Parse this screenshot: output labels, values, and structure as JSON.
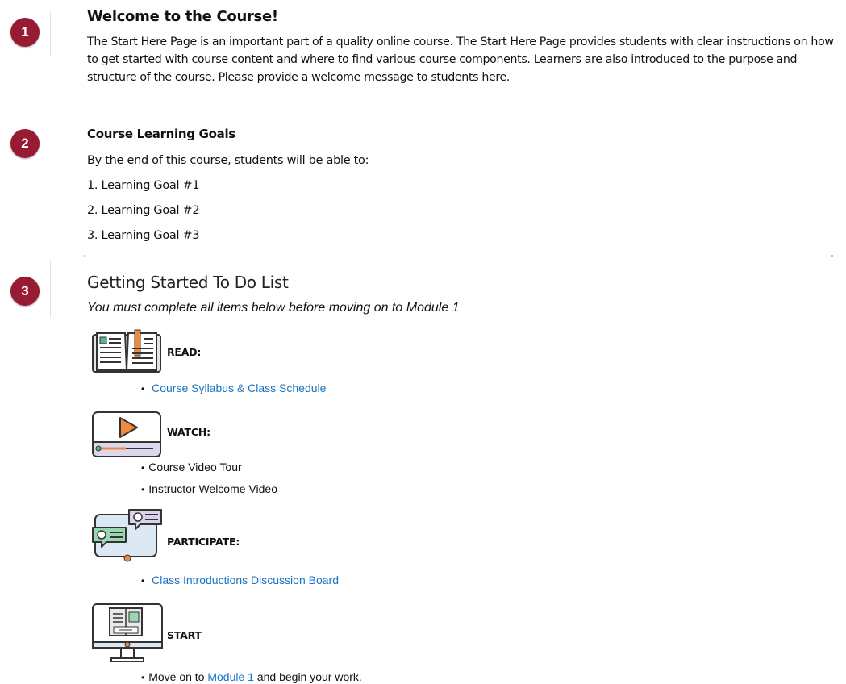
{
  "section1": {
    "badge": "1",
    "title": "Welcome to the Course!",
    "paragraph": "The Start Here Page is an important part of a quality online course. The Start Here Page provides students with clear instructions on how to get started with course content and where to find various course components. Learners are also introduced to the purpose and structure of the course. Please provide a welcome message to students here."
  },
  "section2": {
    "badge": "2",
    "title": "Course Learning Goals",
    "intro": "By the end of this course, students will be able to:",
    "goals": [
      "1. Learning Goal #1",
      "2. Learning Goal #2",
      "3. Learning Goal #3"
    ]
  },
  "section3": {
    "badge": "3",
    "title": "Getting Started To Do List",
    "subtitle": "You must complete all items below before moving on to Module 1",
    "read": {
      "label": "READ:",
      "icon": "open-book-icon",
      "link": "Course Syllabus & Class Schedule"
    },
    "watch": {
      "label": "WATCH:",
      "icon": "video-player-icon",
      "items": [
        "Course Video Tour",
        "Instructor Welcome Video"
      ]
    },
    "participate": {
      "label": "PARTICIPATE:",
      "icon": "discussion-tablet-icon",
      "link": "Class Introductions Discussion Board"
    },
    "start": {
      "label": "START",
      "icon": "computer-monitor-icon",
      "prefix": "Move on to ",
      "link": "Module 1",
      "suffix": " and begin your work."
    }
  },
  "colors": {
    "badge": "#961b33",
    "link": "#1a73c4",
    "accent_orange": "#f08a3c"
  }
}
